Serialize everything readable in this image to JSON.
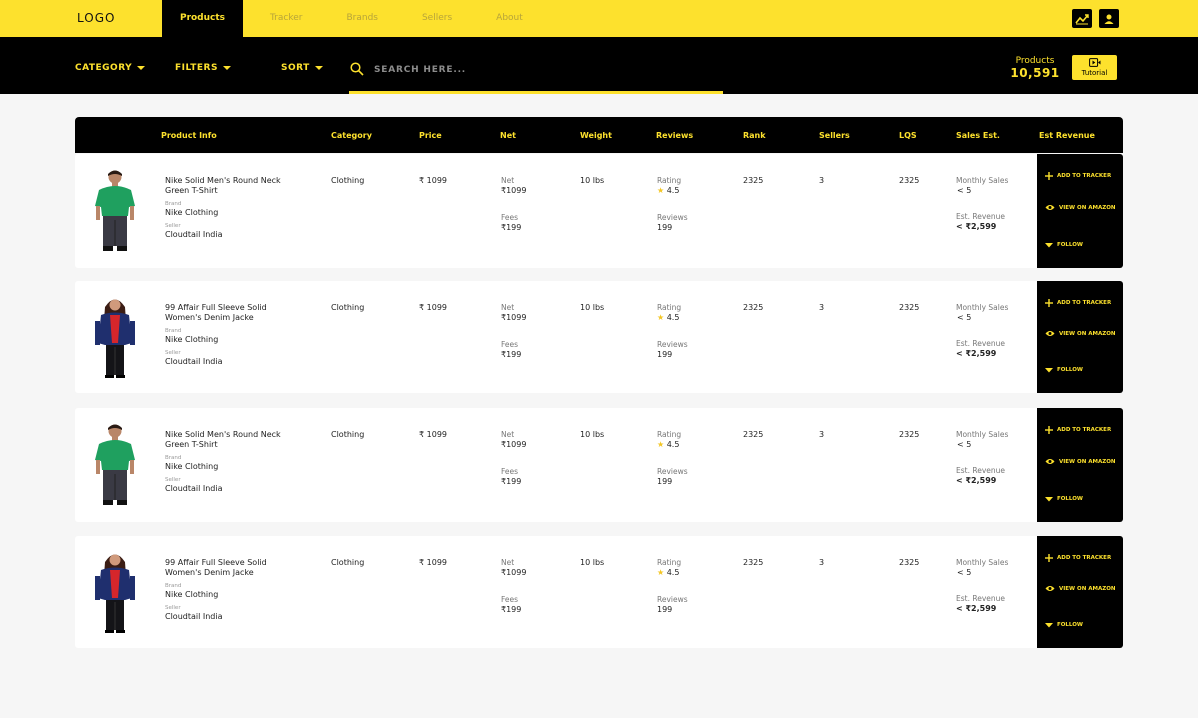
{
  "brand": {
    "logo": "LOGO"
  },
  "colors": {
    "accent": "#fde12d",
    "dark": "#000000",
    "star": "#f3c623"
  },
  "nav": {
    "items": [
      {
        "label": "Products",
        "active": true
      },
      {
        "label": "Tracker"
      },
      {
        "label": "Brands"
      },
      {
        "label": "Sellers"
      },
      {
        "label": "About"
      }
    ]
  },
  "top_icons": [
    "chart-icon",
    "user-icon"
  ],
  "filters": {
    "category": "CATEGORY",
    "filters": "FILTERS",
    "sort": "SORT"
  },
  "search": {
    "placeholder": "SEARCH HERE...",
    "value": ""
  },
  "products_count": {
    "label": "Products",
    "value": "10,591"
  },
  "tutorial": {
    "label": "Tutorial"
  },
  "table": {
    "columns": [
      "Product Info",
      "Category",
      "Price",
      "Net",
      "Weight",
      "Reviews",
      "Rank",
      "Sellers",
      "LQS",
      "Sales Est.",
      "Est Revenue"
    ],
    "rows": [
      {
        "image": "green-tshirt",
        "name_line1": "Nike Solid Men's Round Neck",
        "name_line2": "Green T-Shirt",
        "brand_label": "Brand",
        "brand": "Nike Clothing",
        "seller_label": "Seller",
        "seller": "Cloudtail India",
        "category": "Clothing",
        "price": "₹ 1099",
        "net_label": "Net",
        "net": "₹1099",
        "fees_label": "Fees",
        "fees": "₹199",
        "weight": "10 lbs",
        "rating_label": "Rating",
        "rating": "4.5",
        "reviews_label": "Reviews",
        "reviews": "199",
        "rank": "2325",
        "sellers": "3",
        "lqs": "2325",
        "monthly_label": "Monthly Sales",
        "monthly": "< 5",
        "revenue_label": "Est. Revenue",
        "revenue": "< ₹2,599",
        "act_tracker": "ADD TO TRACKER",
        "act_amazon": "VIEW ON AMAZON",
        "act_follow": "FOLLOW"
      },
      {
        "image": "denim-jacket",
        "name_line1": "99 Affair Full Sleeve Solid",
        "name_line2": "Women's Denim Jacke",
        "brand_label": "Brand",
        "brand": "Nike Clothing",
        "seller_label": "Seller",
        "seller": "Cloudtail India",
        "category": "Clothing",
        "price": "₹ 1099",
        "net_label": "Net",
        "net": "₹1099",
        "fees_label": "Fees",
        "fees": "₹199",
        "weight": "10 lbs",
        "rating_label": "Rating",
        "rating": "4.5",
        "reviews_label": "Reviews",
        "reviews": "199",
        "rank": "2325",
        "sellers": "3",
        "lqs": "2325",
        "monthly_label": "Monthly Sales",
        "monthly": "< 5",
        "revenue_label": "Est. Revenue",
        "revenue": "< ₹2,599",
        "act_tracker": "ADD TO TRACKER",
        "act_amazon": "VIEW ON AMAZON",
        "act_follow": "FOLLOW"
      },
      {
        "image": "green-tshirt",
        "name_line1": "Nike Solid Men's Round Neck",
        "name_line2": "Green T-Shirt",
        "brand_label": "Brand",
        "brand": "Nike Clothing",
        "seller_label": "Seller",
        "seller": "Cloudtail India",
        "category": "Clothing",
        "price": "₹ 1099",
        "net_label": "Net",
        "net": "₹1099",
        "fees_label": "Fees",
        "fees": "₹199",
        "weight": "10 lbs",
        "rating_label": "Rating",
        "rating": "4.5",
        "reviews_label": "Reviews",
        "reviews": "199",
        "rank": "2325",
        "sellers": "3",
        "lqs": "2325",
        "monthly_label": "Monthly Sales",
        "monthly": "< 5",
        "revenue_label": "Est. Revenue",
        "revenue": "< ₹2,599",
        "act_tracker": "ADD TO TRACKER",
        "act_amazon": "VIEW ON AMAZON",
        "act_follow": "FOLLOW"
      },
      {
        "image": "denim-jacket",
        "name_line1": "99 Affair Full Sleeve Solid",
        "name_line2": "Women's Denim Jacke",
        "brand_label": "Brand",
        "brand": "Nike Clothing",
        "seller_label": "Seller",
        "seller": "Cloudtail India",
        "category": "Clothing",
        "price": "₹ 1099",
        "net_label": "Net",
        "net": "₹1099",
        "fees_label": "Fees",
        "fees": "₹199",
        "weight": "10 lbs",
        "rating_label": "Rating",
        "rating": "4.5",
        "reviews_label": "Reviews",
        "reviews": "199",
        "rank": "2325",
        "sellers": "3",
        "lqs": "2325",
        "monthly_label": "Monthly Sales",
        "monthly": "< 5",
        "revenue_label": "Est. Revenue",
        "revenue": "< ₹2,599",
        "act_tracker": "ADD TO TRACKER",
        "act_amazon": "VIEW ON AMAZON",
        "act_follow": "FOLLOW"
      }
    ]
  }
}
